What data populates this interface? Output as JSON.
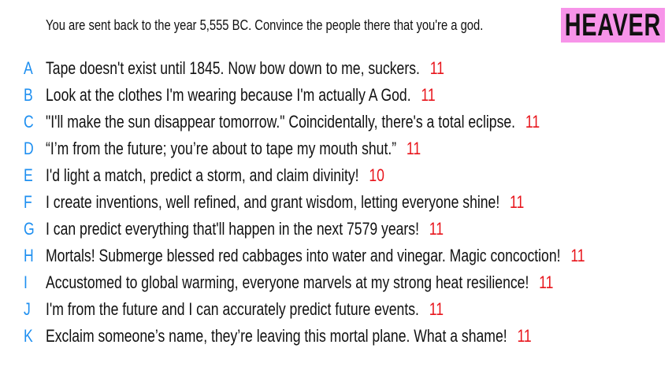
{
  "prompt": "You are sent back to the year 5,555 BC. Convince the people there that you're a god.",
  "logo": "HEAVER",
  "colors": {
    "letter": "#1e8ff0",
    "score": "#e8141b",
    "logo_bg": "#f794e9"
  },
  "answers": [
    {
      "letter": "A",
      "text": "Tape doesn't exist until 1845. Now bow down to me, suckers.",
      "score": "11"
    },
    {
      "letter": "B",
      "text": "Look at the clothes I'm wearing because I'm actually A God.",
      "score": "11"
    },
    {
      "letter": "C",
      "text": "\"I'll make the sun disappear tomorrow.\" Coincidentally, there's a total eclipse.",
      "score": "11"
    },
    {
      "letter": "D",
      "text": "“I’m from the future; you’re about to tape my mouth shut.”",
      "score": "11"
    },
    {
      "letter": "E",
      "text": "I'd light a match, predict a storm, and claim divinity!",
      "score": "10"
    },
    {
      "letter": "F",
      "text": "I create inventions, well refined, and grant wisdom, letting everyone shine!",
      "score": "11"
    },
    {
      "letter": "G",
      "text": "I can predict everything that'll happen in the next 7579 years!",
      "score": "11"
    },
    {
      "letter": "H",
      "text": "Mortals! Submerge blessed red cabbages into water and vinegar. Magic concoction!",
      "score": "11"
    },
    {
      "letter": "I",
      "text": "Accustomed to global warming, everyone marvels at my strong heat resilience!",
      "score": "11"
    },
    {
      "letter": "J",
      "text": "I'm from the future and I can accurately predict future events.",
      "score": "11"
    },
    {
      "letter": "K",
      "text": "Exclaim someone’s name, they’re leaving this mortal plane. What a shame!",
      "score": "11"
    }
  ]
}
